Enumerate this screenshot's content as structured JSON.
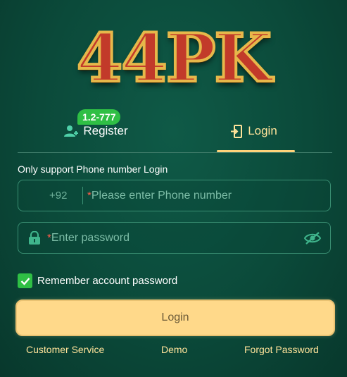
{
  "logo": {
    "text": "44PK"
  },
  "tabs": {
    "register": {
      "label": "Register",
      "badge": "1.2-777"
    },
    "login": {
      "label": "Login"
    }
  },
  "form": {
    "hint": "Only support Phone number Login",
    "phone": {
      "country_code": "+92",
      "required_mark": "*",
      "placeholder": "Please enter Phone number"
    },
    "password": {
      "required_mark": "*",
      "placeholder": "Enter password"
    },
    "remember_label": "Remember account password",
    "login_button": "Login"
  },
  "footer": {
    "customer_service": "Customer Service",
    "demo": "Demo",
    "forgot_password": "Forgot Password"
  },
  "icons": {
    "register": "add-user-icon",
    "login": "door-enter-icon",
    "password": "lock-icon",
    "visibility": "eye-off-icon",
    "remember": "checkmark-icon"
  },
  "colors": {
    "background": "#0b4a3a",
    "accent": "#ffd37a",
    "badge": "#2fbf45",
    "button": "#ffd98a",
    "required": "#ff5a4a"
  }
}
